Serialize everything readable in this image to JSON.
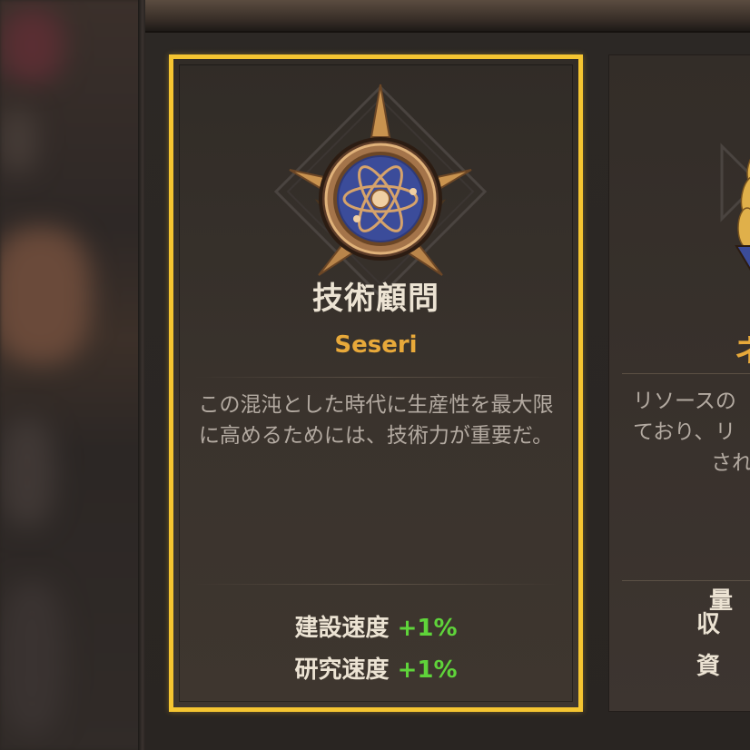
{
  "colors": {
    "selected_border": "#f5c531",
    "title": "#ece3d3",
    "name": "#e8a93a",
    "description": "#b3aaa1",
    "bonus_value": "#5fd43a"
  },
  "cards": [
    {
      "icon": "atom-medal-icon",
      "title": "技術顧問",
      "name": "Seseri",
      "description": "この混沌とした時代に生産性を最大限に高めるためには、技術力が重要だ。",
      "bonuses": [
        {
          "label": "建設速度",
          "value": "+1%"
        },
        {
          "label": "研究速度",
          "value": "+1%"
        }
      ],
      "selected": true
    },
    {
      "icon": "wheat-medal-icon",
      "title_partial": "ネ",
      "description_lines": [
        "リソースの",
        "ており、リ",
        "され"
      ],
      "stat_partial": "量",
      "bonus_partials": [
        "収",
        "資"
      ],
      "selected": false
    }
  ]
}
